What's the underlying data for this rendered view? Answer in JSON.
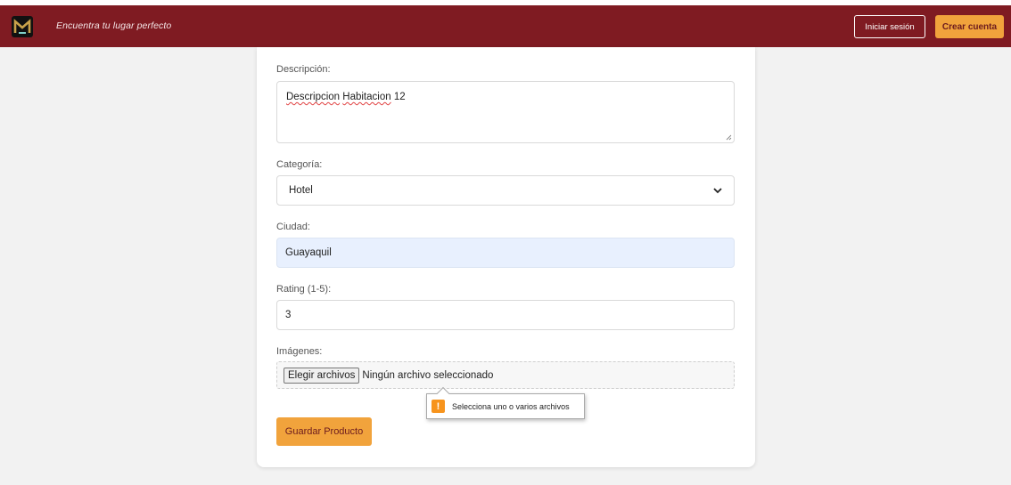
{
  "navbar": {
    "tagline": "Encuentra tu lugar perfecto",
    "login_label": "Iniciar sesión",
    "signup_label": "Crear cuenta"
  },
  "form": {
    "description": {
      "label": "Descripción:",
      "value_word1": "Descripcion",
      "value_word2": "Habitacion",
      "value_rest": " 12"
    },
    "category": {
      "label": "Categoría:",
      "selected": "Hotel"
    },
    "city": {
      "label": "Ciudad:",
      "value": "Guayaquil"
    },
    "rating": {
      "label": "Rating (1-5):",
      "value": "3"
    },
    "images": {
      "label": "Imágenes:",
      "button_label": "Elegir archivos",
      "status": "Ningún archivo seleccionado"
    },
    "validation_tooltip": "Selecciona uno o varios archivos",
    "submit_label": "Guardar Producto"
  },
  "colors": {
    "navbar_bg": "#7f1b22",
    "accent": "#f1a33c",
    "warning": "#f7941d",
    "autofill_bg": "#e8f0fe"
  }
}
